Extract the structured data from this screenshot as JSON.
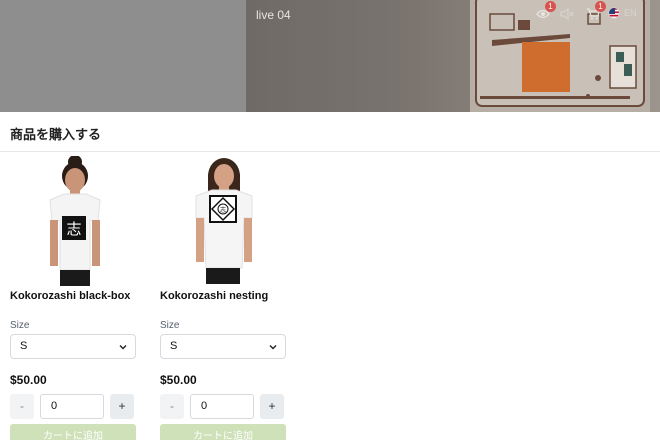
{
  "stream": {
    "title": "live 04",
    "viewer_count": "1",
    "cart_count": "1",
    "language": "EN",
    "icons": [
      "eye-icon",
      "mute-icon",
      "cart-icon",
      "us-flag-icon"
    ]
  },
  "panel": {
    "title": "商品を購入する"
  },
  "products": [
    {
      "name": "Kokorozashi black-box",
      "size_label": "Size",
      "size_value": "S",
      "price": "$50.00",
      "minus": "-",
      "plus": "+",
      "quantity": "0",
      "add_to_cart": "カートに追加",
      "print_glyph": "志"
    },
    {
      "name": "Kokorozashi nesting",
      "size_label": "Size",
      "size_value": "S",
      "price": "$50.00",
      "minus": "-",
      "plus": "+",
      "quantity": "0",
      "add_to_cart": "カートに追加",
      "print_glyph": "志"
    }
  ],
  "colors": {
    "add_to_cart_bg": "#cfe1b9",
    "badge": "#d9534f"
  }
}
